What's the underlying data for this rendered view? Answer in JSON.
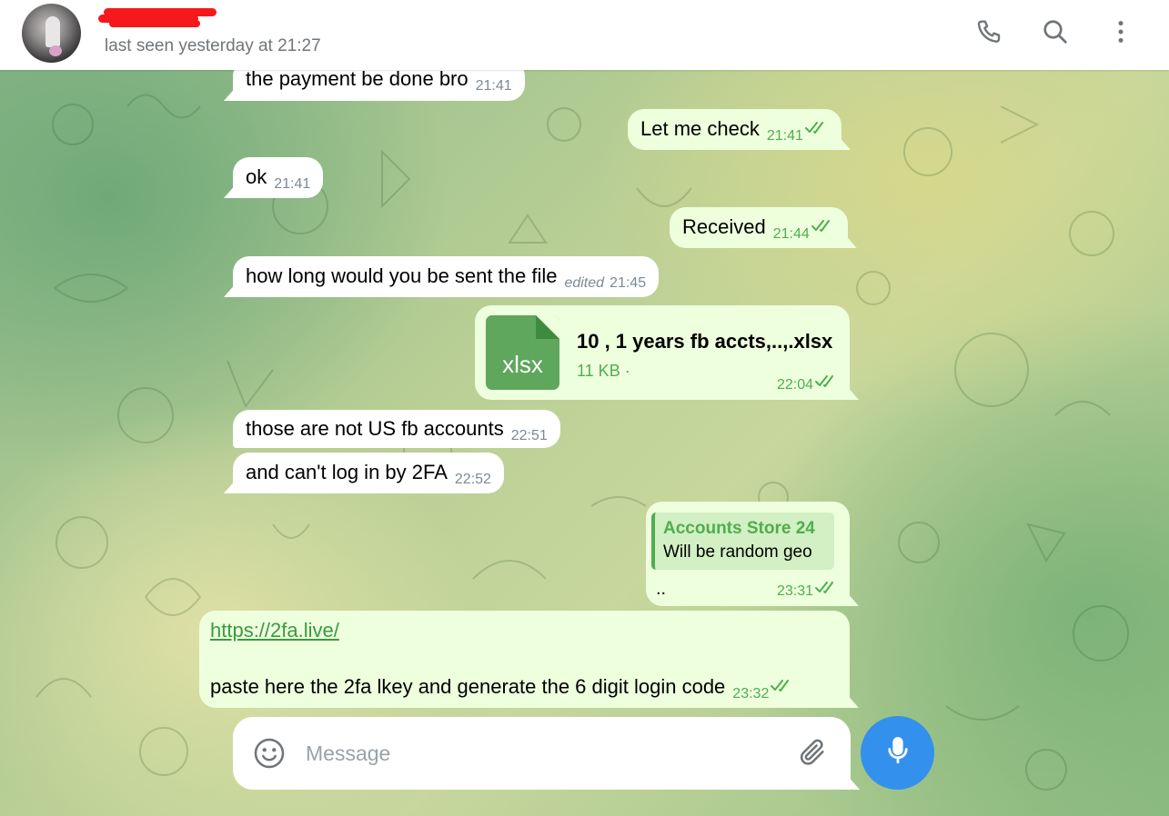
{
  "header": {
    "status": "last seen yesterday at 21:27"
  },
  "messages": [
    {
      "text": "the payment be done bro",
      "time": "21:41"
    },
    {
      "text": "Let me check",
      "time": "21:41"
    },
    {
      "text": "ok",
      "time": "21:41"
    },
    {
      "text": "Received",
      "time": "21:44"
    },
    {
      "text": "how long would you be sent the file",
      "edited": "edited",
      "time": "21:45"
    },
    {
      "file": {
        "ext": "xlsx",
        "name": "10 , 1 years fb accts,..,.xlsx",
        "size": "11 KB ·"
      },
      "time": "22:04"
    },
    {
      "text": "those are not US fb accounts",
      "time": "22:51"
    },
    {
      "text": "and can't log in by 2FA",
      "time": "22:52"
    },
    {
      "reply_to": {
        "name": "Accounts Store 24",
        "text": "Will be random geo"
      },
      "text": "..",
      "time": "23:31"
    },
    {
      "link": "https://2fa.live/",
      "text": "paste here the 2fa lkey and generate the 6 digit login code",
      "time": "23:32"
    }
  ],
  "composer": {
    "placeholder": "Message"
  },
  "colors": {
    "outgoing_bubble": "#eeffde",
    "incoming_bubble": "#ffffff",
    "accent_green": "#4fae4e",
    "mic_button": "#3390ec",
    "redaction": "#f5181c"
  },
  "icons": [
    "phone-icon",
    "search-icon",
    "more-vertical-icon",
    "emoji-icon",
    "attach-icon",
    "mic-icon",
    "read-ticks-icon"
  ]
}
